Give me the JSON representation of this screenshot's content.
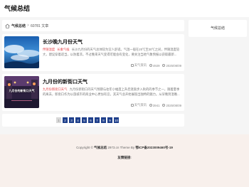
{
  "site": {
    "title": "气候总结"
  },
  "breadcrumb": {
    "home": "气候总结",
    "separator": ">",
    "current": "60781 文章"
  },
  "articles": [
    {
      "title": "长沙晚九月份天气",
      "thumb_text": "",
      "tags": [
        "伴随温度",
        "长乘气候"
      ],
      "summary": "长沙九月份的天气总体较为宜人舒适。气温一般在20℃至30℃之间，伴随温度较大，建议穿着适当，以防着凉。不过晚来天气变得可能会有变化，要关注当地气象预报以获取最新...",
      "category": "天气资讯",
      "views": "4929",
      "date": "2025/08/09"
    },
    {
      "title": "九月份的新街口天气",
      "thumb_text": "九月份的新街口天气",
      "tags": [
        "九月份新街口天气"
      ],
      "summary": "九月份新街口的天气预期与往年小幅度上升后逐渐步入秋的的季节之一，随着夏季的离去，新街口作为以旅城市的商业中心更加有宜，其天气总开始展现出独特的魅力。从早晚到温晚...",
      "category": "天气资讯",
      "views": "3941",
      "date": "2025/08/09"
    }
  ],
  "pagination": {
    "pages": [
      "1",
      "2",
      "3",
      "4",
      "5",
      "6",
      "7",
      "8",
      "9",
      "10"
    ],
    "current": "1"
  },
  "sidebar": {
    "title": "气候总结"
  },
  "footer": {
    "copyright_prefix": "Copyright ©",
    "site_name": "气候总结",
    "theme_text": "2973.cn Theme By",
    "icp": "鄂ICP备2023009460号-19",
    "links_label": "友情链接:"
  },
  "colors": {
    "accent": "#1e3f8b",
    "tag": "#e5484d",
    "footer_bg": "#f8f0ec"
  }
}
